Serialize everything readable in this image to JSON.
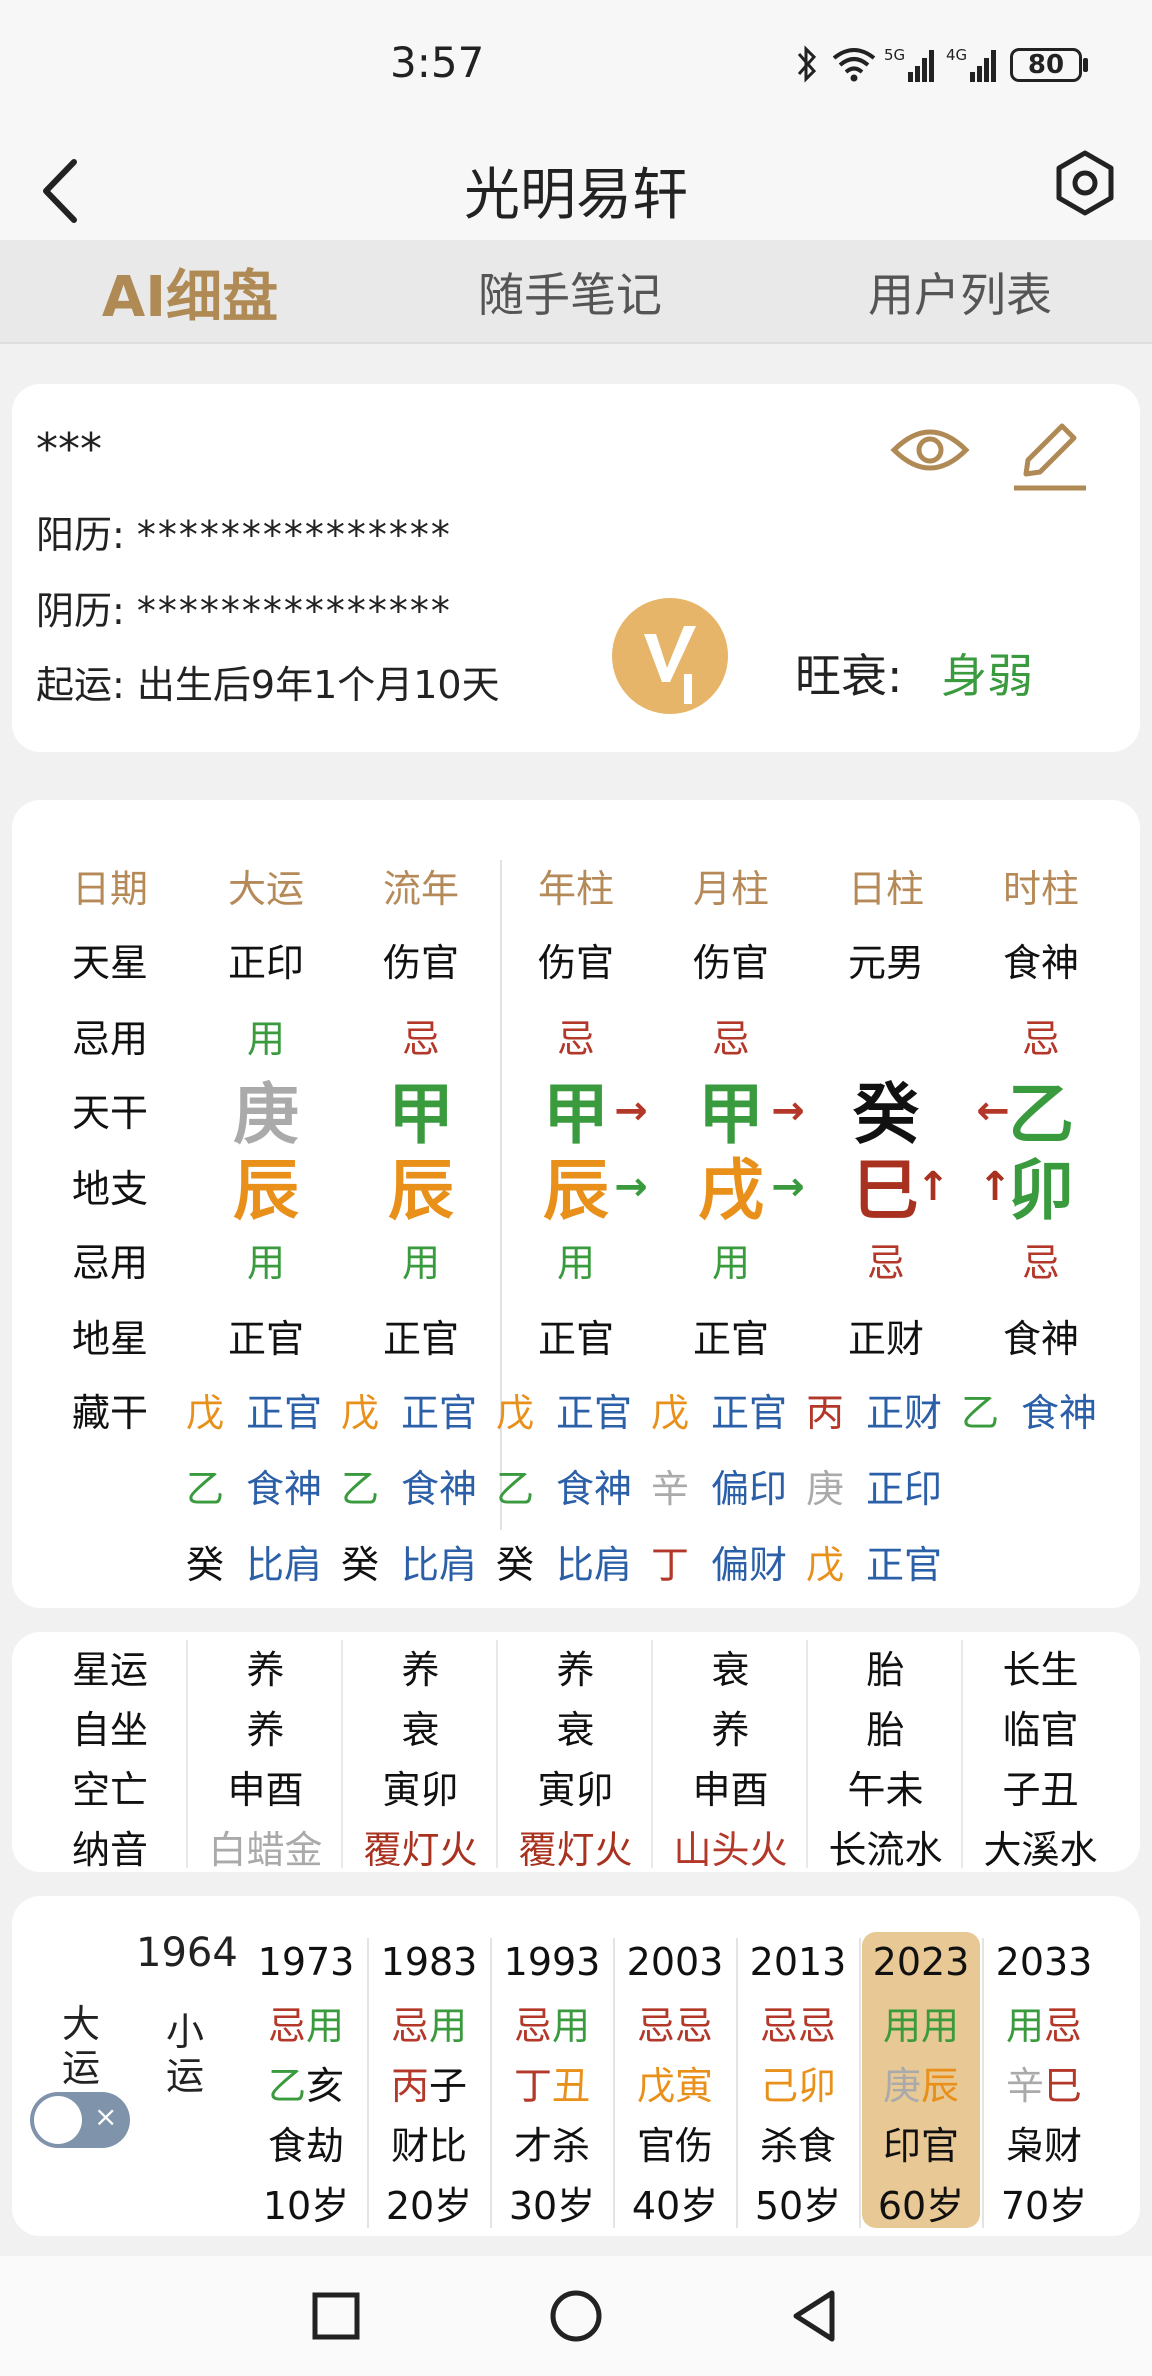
{
  "status": {
    "time": "3:57",
    "battery": "80"
  },
  "header": {
    "title": "光明易轩"
  },
  "tabs": [
    "AI细盘",
    "随手笔记",
    "用户列表"
  ],
  "info": {
    "name": "***",
    "solar_label": "阳历:",
    "solar_value": "***************",
    "lunar_label": "阴历:",
    "lunar_value": "***************",
    "qiyun_label": "起运:",
    "qiyun_value": "出生后9年1个月10天",
    "wangshuai_label": "旺衰:",
    "wangshuai_value": "身弱"
  },
  "pillars": {
    "row_labels": [
      "日期",
      "天星",
      "忌用",
      "天干",
      "地支",
      "忌用",
      "地星",
      "藏干"
    ],
    "headers": [
      "大运",
      "流年",
      "年柱",
      "月柱",
      "日柱",
      "时柱"
    ],
    "tianxing": [
      "正印",
      "伤官",
      "伤官",
      "伤官",
      "元男",
      "食神"
    ],
    "jiyong1": [
      "用",
      "忌",
      "忌",
      "忌",
      "",
      "忌"
    ],
    "tiangan": [
      "庚",
      "甲",
      "甲",
      "甲",
      "癸",
      "乙"
    ],
    "dizhi": [
      "辰",
      "辰",
      "辰",
      "戌",
      "巳",
      "卯"
    ],
    "jiyong2": [
      "用",
      "用",
      "用",
      "用",
      "忌",
      "忌"
    ],
    "dixing": [
      "正官",
      "正官",
      "正官",
      "正官",
      "正财",
      "食神"
    ],
    "canggan": [
      [
        [
          "戊",
          "正官"
        ],
        [
          "乙",
          "食神"
        ],
        [
          "癸",
          "比肩"
        ]
      ],
      [
        [
          "戊",
          "正官"
        ],
        [
          "乙",
          "食神"
        ],
        [
          "癸",
          "比肩"
        ]
      ],
      [
        [
          "戊",
          "正官"
        ],
        [
          "乙",
          "食神"
        ],
        [
          "癸",
          "比肩"
        ]
      ],
      [
        [
          "戊",
          "正官"
        ],
        [
          "辛",
          "偏印"
        ],
        [
          "丁",
          "偏财"
        ]
      ],
      [
        [
          "丙",
          "正财"
        ],
        [
          "庚",
          "正印"
        ],
        [
          "戊",
          "正官"
        ]
      ],
      [
        [
          "乙",
          "食神"
        ],
        [
          "",
          ""
        ],
        [
          "",
          ""
        ]
      ]
    ],
    "arrows": [
      "→",
      "→",
      "→",
      "→",
      "←",
      "↑",
      "↑"
    ]
  },
  "star_yun": {
    "labels": [
      "星运",
      "自坐",
      "空亡",
      "纳音"
    ],
    "cols": [
      [
        "养",
        "养",
        "申酉",
        "白蜡金"
      ],
      [
        "养",
        "衰",
        "寅卯",
        "覆灯火"
      ],
      [
        "养",
        "衰",
        "寅卯",
        "覆灯火"
      ],
      [
        "衰",
        "养",
        "申酉",
        "山头火"
      ],
      [
        "胎",
        "胎",
        "午未",
        "长流水"
      ],
      [
        "长生",
        "临官",
        "子丑",
        "大溪水"
      ]
    ]
  },
  "dayun": {
    "label1": "大运",
    "label2": "小运",
    "first_year": "1964",
    "cols": [
      {
        "year": "1973",
        "jy": [
          "忌",
          "用"
        ],
        "gz": [
          "乙",
          "亥"
        ],
        "ss": "食劫",
        "age": "10岁"
      },
      {
        "year": "1983",
        "jy": [
          "忌",
          "用"
        ],
        "gz": [
          "丙",
          "子"
        ],
        "ss": "财比",
        "age": "20岁"
      },
      {
        "year": "1993",
        "jy": [
          "忌",
          "用"
        ],
        "gz": [
          "丁",
          "丑"
        ],
        "ss": "才杀",
        "age": "30岁"
      },
      {
        "year": "2003",
        "jy": [
          "忌",
          "忌"
        ],
        "gz": [
          "戊",
          "寅"
        ],
        "ss": "官伤",
        "age": "40岁"
      },
      {
        "year": "2013",
        "jy": [
          "忌",
          "忌"
        ],
        "gz": [
          "己",
          "卯"
        ],
        "ss": "杀食",
        "age": "50岁"
      },
      {
        "year": "2023",
        "jy": [
          "用",
          "用"
        ],
        "gz": [
          "庚",
          "辰"
        ],
        "ss": "印官",
        "age": "60岁"
      },
      {
        "year": "2033",
        "jy": [
          "用",
          "忌"
        ],
        "gz": [
          "辛",
          "巳"
        ],
        "ss": "枭财",
        "age": "70岁"
      }
    ]
  },
  "colors": {
    "accent": "#b08a55",
    "green": "#3a9a3e",
    "red": "#b3382a",
    "orange": "#e8901a",
    "blue": "#2b5fa8"
  },
  "icons": [
    "back-arrow-icon",
    "settings-hexagon-icon",
    "eye-icon",
    "edit-icon",
    "vip-badge-icon"
  ]
}
